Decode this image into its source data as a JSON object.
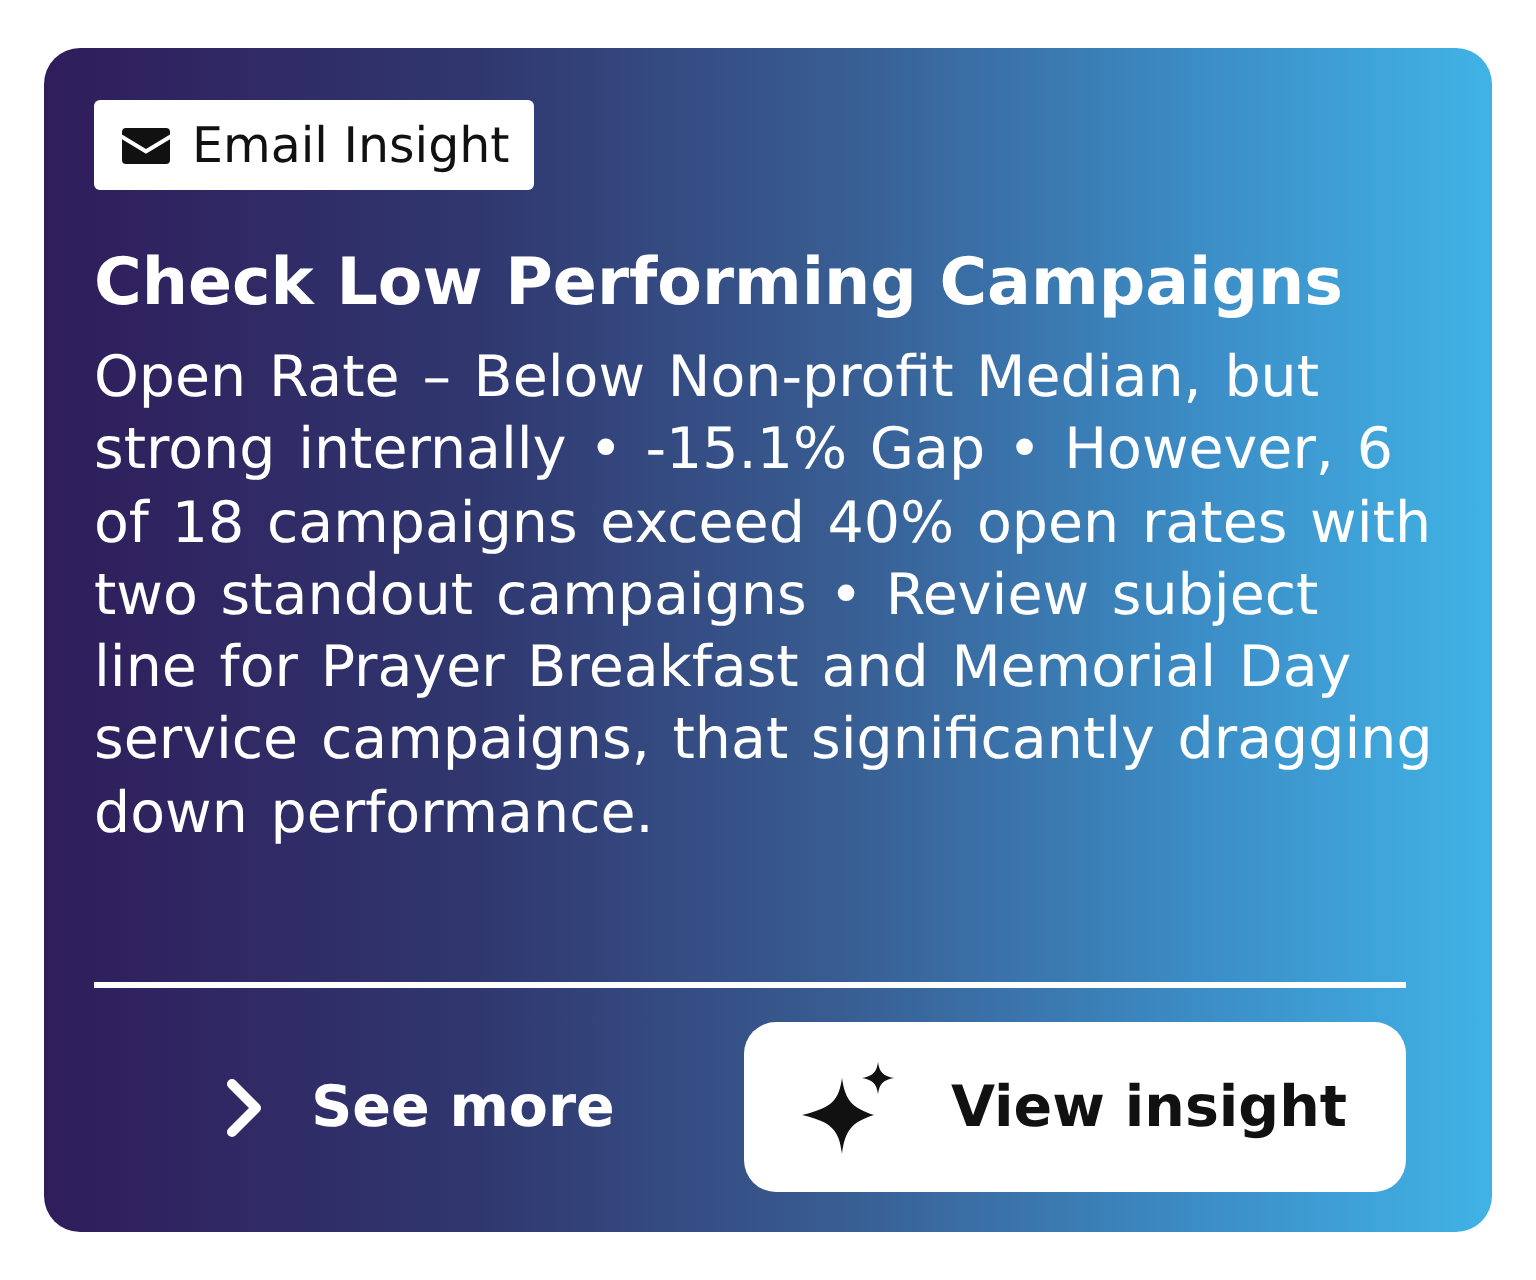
{
  "badge": {
    "label": "Email Insight"
  },
  "title": "Check Low Performing Campaigns",
  "description": "Open Rate – Below Non-profit Median, but strong internally • -15.1% Gap • However, 6 of 18 campaigns exceed 40% open rates with two standout campaigns • Review subject line for Prayer Breakfast and Memorial Day service campaigns, that significantly dragging down performance.",
  "actions": [
    {
      "kind": "link",
      "label": "See more"
    },
    {
      "kind": "button",
      "label": "View insight"
    }
  ]
}
